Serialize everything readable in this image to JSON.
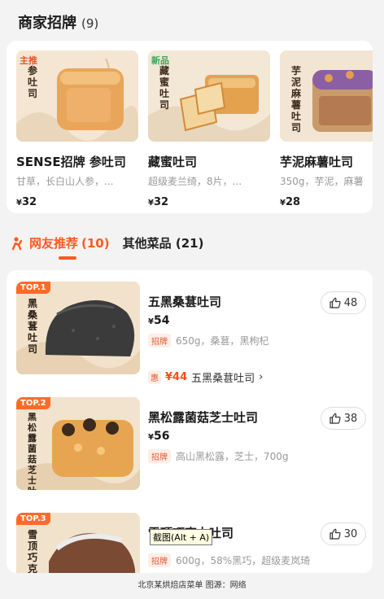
{
  "signature_section": {
    "title": "商家招牌",
    "count": "(9)",
    "items": [
      {
        "tag": "主推",
        "tag_color": "#e4572e",
        "vertical": "参吐司",
        "name": "SENSE招牌 参吐司",
        "desc": "甘草，长白山人参，...",
        "yen": "¥",
        "price": "32"
      },
      {
        "tag": "新品",
        "tag_color": "#3aa655",
        "vertical": "藏蜜吐司",
        "name": "藏蜜吐司",
        "desc": "超级麦兰绮，8片，...",
        "yen": "¥",
        "price": "32"
      },
      {
        "tag": "",
        "tag_color": "#e4572e",
        "vertical": "芋泥麻薯吐司",
        "name": "芋泥麻薯吐司",
        "desc": "350g，芋泥，麻薯",
        "yen": "¥",
        "price": "28"
      }
    ]
  },
  "tabs": {
    "active_label": "网友推荐",
    "active_count": "(10)",
    "other_label": "其他菜品",
    "other_count": "(21)"
  },
  "recommend": [
    {
      "badge": "TOP.1",
      "vertical": "黑桑葚吐司",
      "name": "五黑桑葚吐司",
      "yen": "¥",
      "price": "54",
      "pill": "招牌",
      "desc": "650g，桑葚，黑枸杞",
      "likes": "48",
      "deal": {
        "hui": "惠",
        "price": "¥44",
        "name": "五黑桑葚吐司",
        "arrow": "›"
      }
    },
    {
      "badge": "TOP.2",
      "vertical": "黑松露菌菇芝士吐司",
      "name": "黑松露菌菇芝士吐司",
      "yen": "¥",
      "price": "56",
      "pill": "招牌",
      "desc": "高山黑松露，芝士，700g",
      "likes": "38"
    },
    {
      "badge": "TOP.3",
      "vertical": "雪顶巧克力吐司",
      "name": "雪顶巧克力吐司",
      "yen": "¥",
      "price": "",
      "pill": "招牌",
      "desc": "600g，58%黑巧，超级麦岚琦",
      "likes": "30"
    }
  ],
  "tooltip": "截图(Alt + A)",
  "footer": "北京某烘焙店菜单 图源：网络",
  "colors": {
    "accent": "#ff5a1f",
    "badge": "#ff6a2a"
  }
}
